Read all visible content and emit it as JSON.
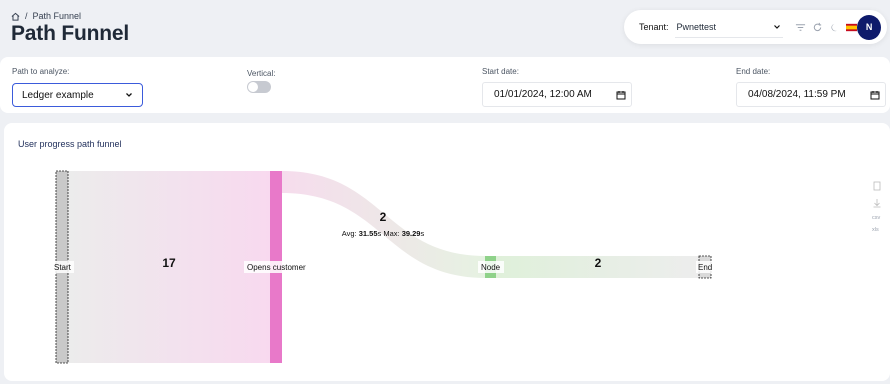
{
  "breadcrumb": {
    "separator": "/",
    "current": "Path Funnel"
  },
  "page_title": "Path Funnel",
  "topbar": {
    "tenant_label": "Tenant:",
    "tenant_value": "Pwnettest",
    "avatar_initial": "N",
    "icons": [
      "filter-icon",
      "refresh-icon",
      "moon-icon",
      "spain-flag-icon"
    ]
  },
  "filters": {
    "path_label": "Path to analyze:",
    "path_value": "Ledger example",
    "vertical_label": "Vertical:",
    "vertical_on": false,
    "start_label": "Start date:",
    "start_value": "01/01/2024, 12:00 AM",
    "end_label": "End date:",
    "end_value": "04/08/2024, 11:59 PM"
  },
  "panel": {
    "title": "User progress path funnel",
    "export_options": [
      "csv",
      "xls"
    ],
    "export_icons": [
      "document-icon",
      "download-icon"
    ]
  },
  "funnel": {
    "nodes": [
      {
        "label": "Start",
        "color": "#c9c9c9"
      },
      {
        "label": "Opens customer",
        "color": "#e879c9"
      },
      {
        "label": "Node",
        "color": "#8fd28a"
      },
      {
        "label": "End",
        "color": "#d9d9d9"
      }
    ],
    "links": [
      {
        "from": "Start",
        "to": "Opens customer",
        "value": "17"
      },
      {
        "from": "Opens customer",
        "to": "Node",
        "value": "2",
        "avg_label": "Avg:",
        "avg": "31.55",
        "avg_unit": "s",
        "max_label": "Max:",
        "max": "39.29",
        "max_unit": "s"
      },
      {
        "from": "Node",
        "to": "End",
        "value": "2"
      }
    ]
  },
  "colors": {
    "accent": "#3b5bdb",
    "avatar": "#0e1a6b"
  }
}
